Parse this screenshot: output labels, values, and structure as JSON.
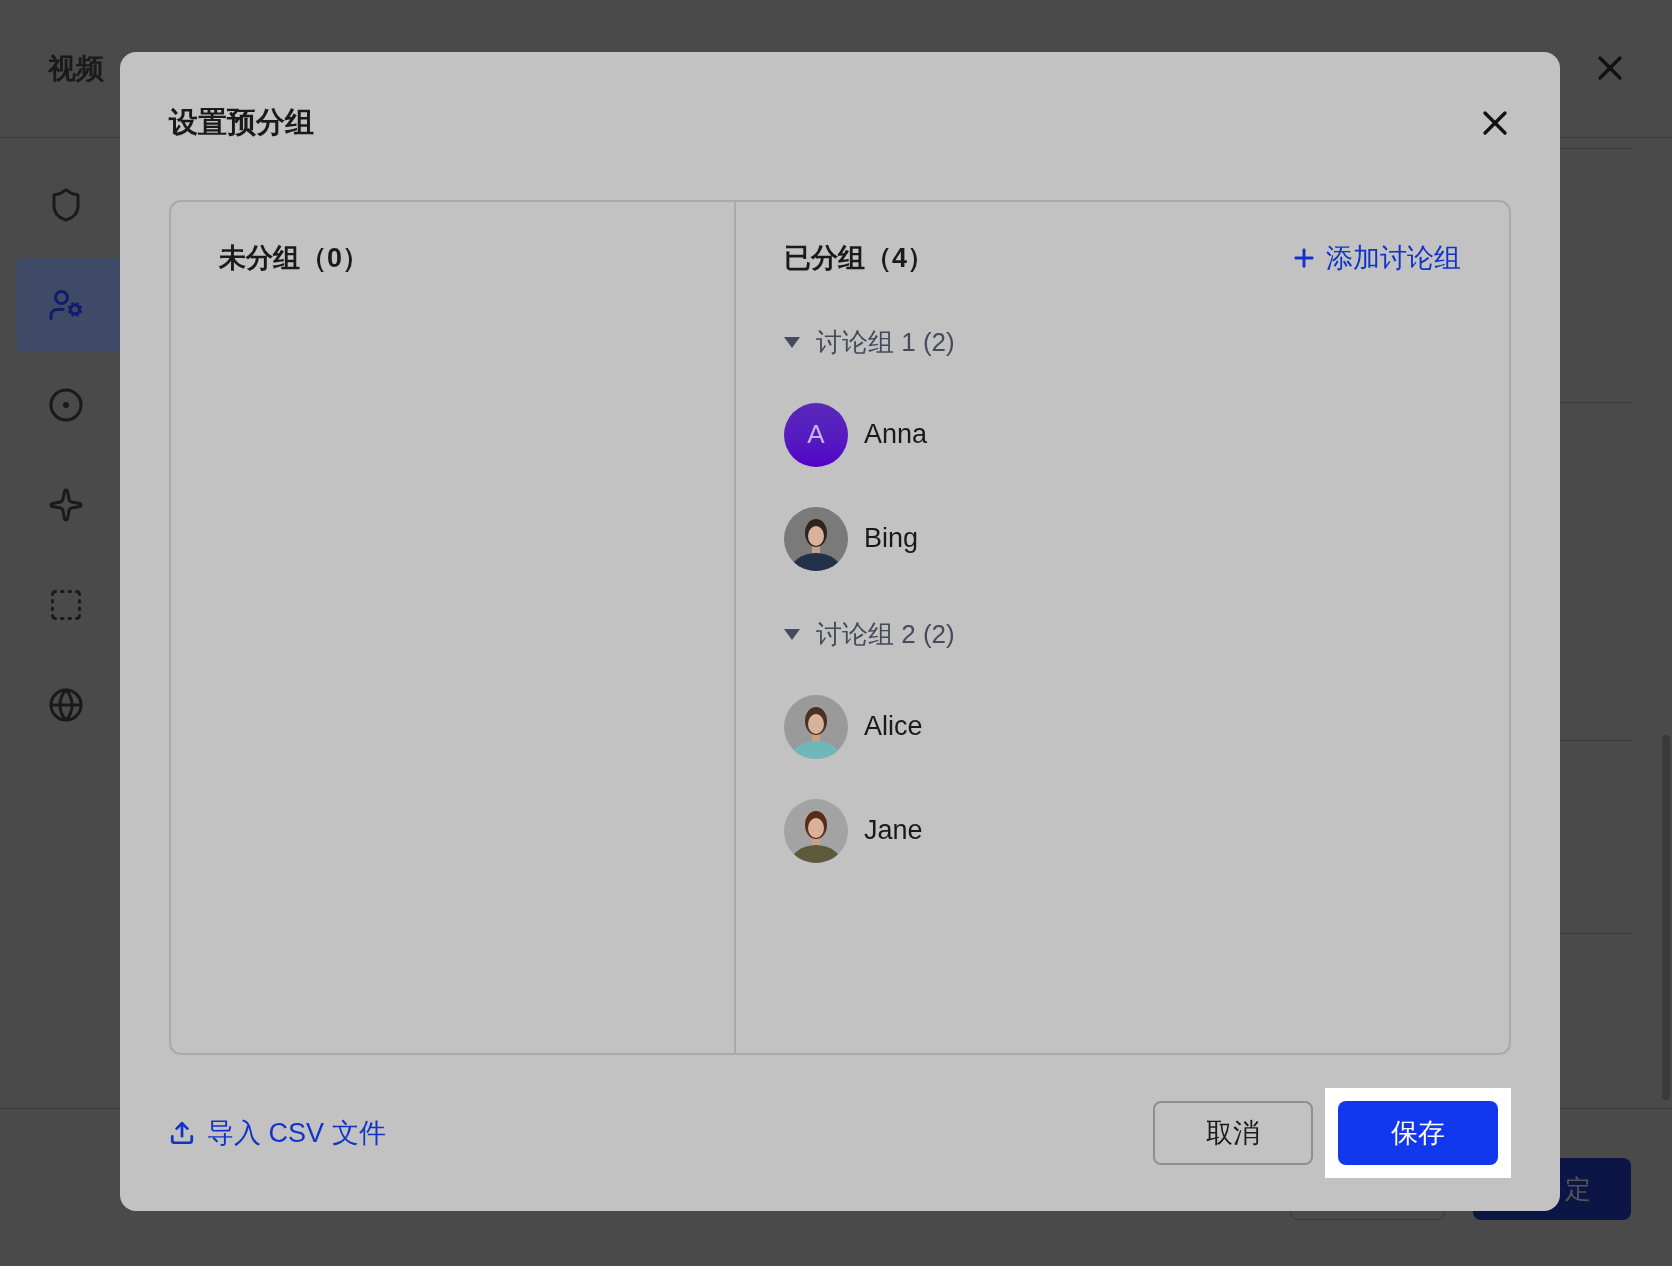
{
  "background": {
    "title": "视频",
    "sidebar": [
      {
        "selected": false
      },
      {
        "selected": true
      },
      {
        "selected": false
      },
      {
        "selected": false
      },
      {
        "selected": false
      },
      {
        "selected": false
      }
    ],
    "confirm_button": "定"
  },
  "dialog": {
    "title": "设置预分组",
    "ungrouped": {
      "heading": "未分组（0）"
    },
    "grouped": {
      "heading": "已分组（4）",
      "add_button": "添加讨论组",
      "groups": [
        {
          "name": "讨论组 1",
          "count": "(2)",
          "expanded": true,
          "members": [
            {
              "name": "Anna",
              "kind": "letter",
              "initial": "A"
            },
            {
              "name": "Bing"
            }
          ]
        },
        {
          "name": "讨论组 2",
          "count": "(2)",
          "expanded": true,
          "members": [
            {
              "name": "Alice"
            },
            {
              "name": "Jane"
            }
          ]
        }
      ]
    },
    "import_link": "导入 CSV 文件",
    "cancel_button": "取消",
    "save_button": "保存"
  }
}
